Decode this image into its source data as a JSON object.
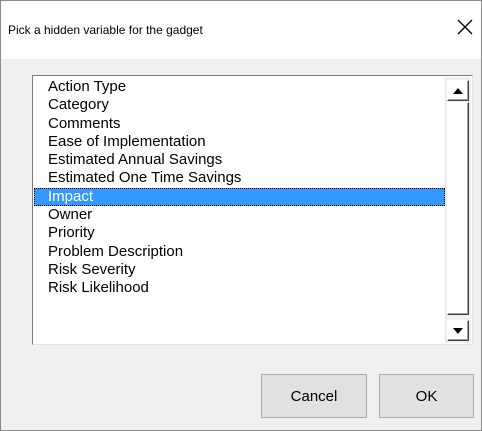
{
  "window": {
    "title": "Pick a hidden variable for the gadget",
    "close_icon": "close-icon"
  },
  "list": {
    "items": [
      {
        "label": "Action Type",
        "selected": false
      },
      {
        "label": "Category",
        "selected": false
      },
      {
        "label": "Comments",
        "selected": false
      },
      {
        "label": "Ease of Implementation",
        "selected": false
      },
      {
        "label": "Estimated Annual Savings",
        "selected": false
      },
      {
        "label": "Estimated One Time Savings",
        "selected": false
      },
      {
        "label": "Impact",
        "selected": true
      },
      {
        "label": "Owner",
        "selected": false
      },
      {
        "label": "Priority",
        "selected": false
      },
      {
        "label": "Problem Description",
        "selected": false
      },
      {
        "label": "Risk Severity",
        "selected": false
      },
      {
        "label": "Risk Likelihood",
        "selected": false
      }
    ],
    "scroll_up_icon": "triangle-up-icon",
    "scroll_down_icon": "triangle-down-icon"
  },
  "buttons": {
    "cancel_label": "Cancel",
    "ok_label": "OK"
  },
  "colors": {
    "selection": "#3399ff",
    "dialog_bg": "#f0f0f0",
    "titlebar_bg": "#ffffff"
  }
}
